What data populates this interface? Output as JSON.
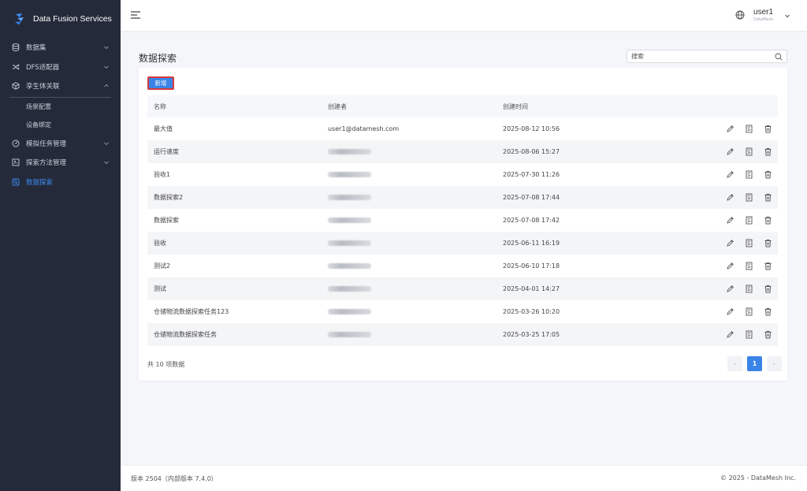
{
  "brand": {
    "title": "Data Fusion Services",
    "logo_color": "#3d8bf2"
  },
  "sidebar": {
    "items": [
      {
        "label": "数据集",
        "icon": "database-icon",
        "chevron": "down"
      },
      {
        "label": "DFS适配器",
        "icon": "shuffle-icon",
        "chevron": "down"
      },
      {
        "label": "孪生体关联",
        "icon": "cube-icon",
        "chevron": "up",
        "expanded": true,
        "children": [
          "场景配置",
          "设备绑定"
        ]
      },
      {
        "label": "模拟任务管理",
        "icon": "gauge-icon",
        "chevron": "down"
      },
      {
        "label": "探索方法管理",
        "icon": "method-icon",
        "chevron": "down"
      },
      {
        "label": "数据探索",
        "icon": "explore-icon",
        "active": true
      }
    ]
  },
  "header": {
    "user_name": "user1",
    "user_org": "DataMesh"
  },
  "page": {
    "title": "数据探索",
    "search_placeholder": "搜索",
    "add_label": "新增"
  },
  "table": {
    "columns": [
      "名称",
      "创建者",
      "创建时间"
    ],
    "rows": [
      {
        "name": "最大值",
        "creator": "user1@datamesh.com",
        "time": "2025-08-12 10:56"
      },
      {
        "name": "运行速度",
        "creator": "",
        "time": "2025-08-06 15:27"
      },
      {
        "name": "验收1",
        "creator": "",
        "time": "2025-07-30 11:26"
      },
      {
        "name": "数据探索2",
        "creator": "",
        "time": "2025-07-08 17:44"
      },
      {
        "name": "数据探索",
        "creator": "",
        "time": "2025-07-08 17:42"
      },
      {
        "name": "验收",
        "creator": "",
        "time": "2025-06-11 16:19"
      },
      {
        "name": "测试2",
        "creator": "",
        "time": "2025-06-10 17:18"
      },
      {
        "name": "测试",
        "creator": "",
        "time": "2025-04-01 14:27"
      },
      {
        "name": "仓储物流数据探索任务123",
        "creator": "",
        "time": "2025-03-26 10:20"
      },
      {
        "name": "仓储物流数据探索任务",
        "creator": "",
        "time": "2025-03-25 17:05"
      }
    ],
    "row_actions": [
      "edit-icon",
      "report-icon",
      "delete-icon"
    ]
  },
  "pagination": {
    "total_text": "共 10 项数据",
    "current": "1",
    "prev": "‹",
    "next": "›"
  },
  "footer": {
    "version": "版本 2504（内部版本 7.4.0）",
    "copyright": "© 2025 - DataMesh Inc."
  }
}
